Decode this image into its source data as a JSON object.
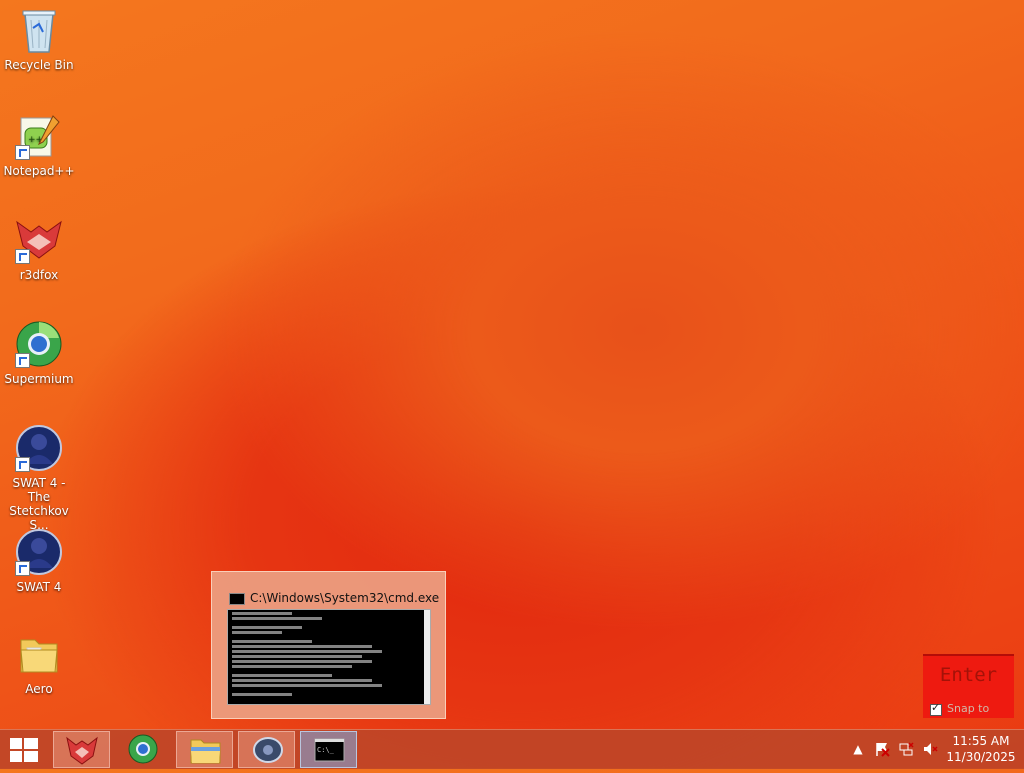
{
  "desktop_icons": [
    {
      "label": "Recycle Bin",
      "icon": "recycle-bin-icon"
    },
    {
      "label": "Notepad++",
      "icon": "notepad-plus-plus-icon"
    },
    {
      "label": "r3dfox",
      "icon": "r3dfox-icon"
    },
    {
      "label": "Supermium",
      "icon": "supermium-icon"
    },
    {
      "label": "SWAT 4 - The Stetchkov S...",
      "icon": "swat4-stetchkov-icon"
    },
    {
      "label": "SWAT 4",
      "icon": "swat4-icon"
    },
    {
      "label": "Aero",
      "icon": "folder-icon"
    }
  ],
  "preview": {
    "title": "C:\\Windows\\System32\\cmd.exe"
  },
  "enter_widget": {
    "label": "Enter",
    "snap_label": "Snap to"
  },
  "taskbar": {
    "pinned": [
      "r3dfox-icon",
      "supermium-icon",
      "file-explorer-icon",
      "swat4-icon",
      "cmd-icon"
    ]
  },
  "clock": {
    "time": "11:55 AM",
    "date": "11/30/2025"
  },
  "colors": {
    "accent": "#ee1a10",
    "taskbar": "#be4628"
  }
}
